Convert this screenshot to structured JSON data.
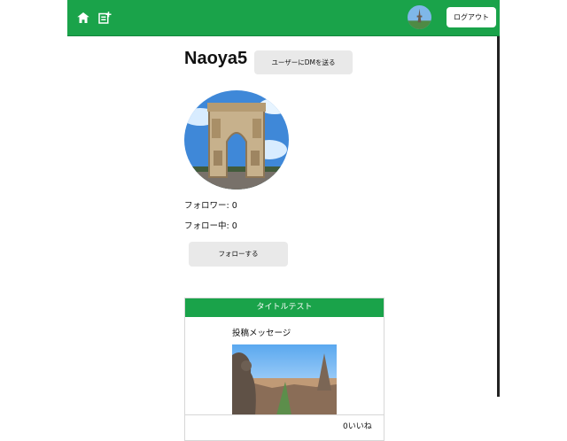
{
  "header": {
    "home_icon": "home-icon",
    "new_post_icon": "new-post-icon",
    "logout_label": "ログアウト",
    "theme_color": "#1aa34a"
  },
  "profile": {
    "username": "Naoya5",
    "dm_button_label": "ユーザーにDMを送る",
    "followers_text": "フォロワー: 0",
    "following_text": "フォロー中: 0",
    "follow_button_label": "フォローする"
  },
  "post": {
    "title": "タイトルテスト",
    "message": "投稿メッセージ",
    "likes_text": "0いいね"
  }
}
